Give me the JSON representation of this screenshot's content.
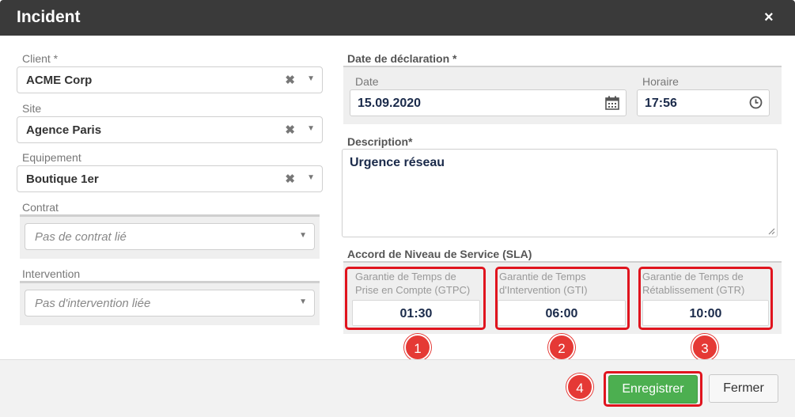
{
  "dialog": {
    "title": "Incident",
    "close_icon": "×"
  },
  "left": {
    "client": {
      "label": "Client *",
      "value": "ACME Corp"
    },
    "site": {
      "label": "Site",
      "value": "Agence Paris"
    },
    "equipement": {
      "label": "Equipement",
      "value": "Boutique 1er"
    },
    "contrat": {
      "label": "Contrat",
      "placeholder": "Pas de contrat lié"
    },
    "intervention": {
      "label": "Intervention",
      "placeholder": "Pas d'intervention liée"
    },
    "clear_glyph": "✖",
    "arrow_glyph": "▼"
  },
  "declaration": {
    "section_label": "Date de déclaration *",
    "date_label": "Date",
    "date_value": "15.09.2020",
    "time_label": "Horaire",
    "time_value": "17:56"
  },
  "description": {
    "label": "Description*",
    "value": "Urgence réseau"
  },
  "sla": {
    "section_label": "Accord de Niveau de Service (SLA)",
    "items": [
      {
        "line1": "Garantie de Temps de",
        "line2": "Prise en Compte (GTPC)",
        "value": "01:30",
        "badge": "1"
      },
      {
        "line1": "Garantie de Temps",
        "line2": "d'Intervention (GTI)",
        "value": "06:00",
        "badge": "2"
      },
      {
        "line1": "Garantie de Temps de",
        "line2": "Rétablissement (GTR)",
        "value": "10:00",
        "badge": "3"
      }
    ]
  },
  "footer": {
    "save_label": "Enregistrer",
    "save_badge": "4",
    "close_label": "Fermer"
  },
  "colors": {
    "header": "#3a3a3a",
    "primary": "#4caf50",
    "highlight": "#e0141e",
    "badge": "#e53935"
  }
}
